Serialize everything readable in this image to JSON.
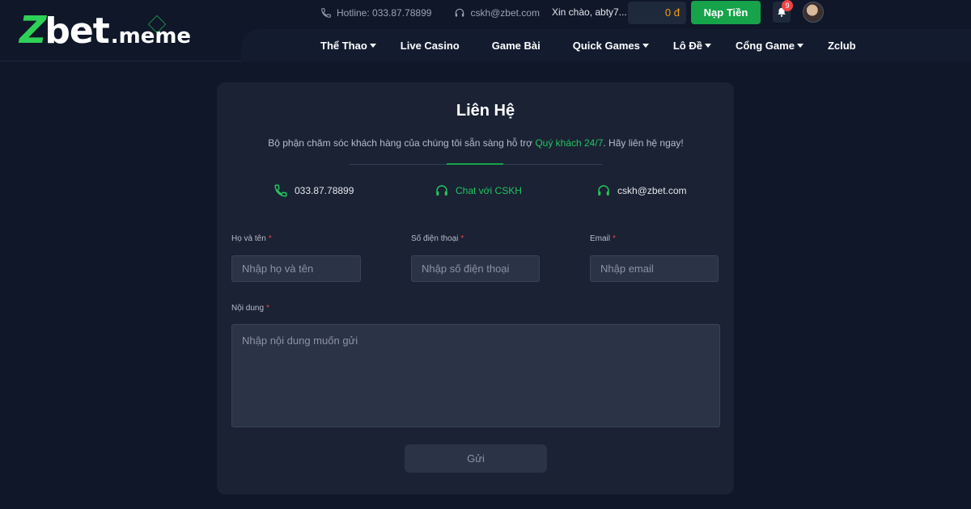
{
  "brand": {
    "logo_z": "Z",
    "logo_bet": "bet",
    "logo_domain": ".meme"
  },
  "topbar": {
    "hotline": "Hotline: 033.87.78899",
    "email": "cskh@zbet.com",
    "greeting": "Xin chào, abty7...",
    "balance": "0 đ",
    "deposit_label": "Nạp Tiền",
    "notification_count": "9"
  },
  "nav": {
    "items": [
      {
        "label": "Thể Thao",
        "dropdown": true
      },
      {
        "label": "Live Casino",
        "dropdown": false
      },
      {
        "label": "Game Bài",
        "dropdown": false
      },
      {
        "label": "Quick Games",
        "dropdown": true
      },
      {
        "label": "Lô Đề",
        "dropdown": true
      },
      {
        "label": "Cổng Game",
        "dropdown": true
      },
      {
        "label": "Zclub",
        "dropdown": false
      }
    ]
  },
  "contact_page": {
    "title": "Liên Hệ",
    "subtitle_start": "Bộ phận chăm sóc khách hàng của chúng tôi sẵn sàng hỗ trợ ",
    "subtitle_highlight": "Quý khách 24/7",
    "subtitle_end": ". Hãy liên hệ ngay!",
    "phone": "033.87.78899",
    "chat": "Chat với CSKH",
    "email": "cskh@zbet.com"
  },
  "form": {
    "name_label": "Họ và tên",
    "name_placeholder": "Nhập họ và tên",
    "phone_label": "Số điện thoại",
    "phone_placeholder": "Nhập số điện thoại",
    "email_label": "Email",
    "email_placeholder": "Nhập email",
    "message_label": "Nội dung",
    "message_placeholder": "Nhập nội dung muốn gửi",
    "required_mark": "*",
    "submit_label": "Gửi"
  },
  "colors": {
    "accent": "#16a34a",
    "highlight": "#22c55e",
    "balance": "#f59e0b",
    "required": "#ef4444",
    "background": "#0f1729",
    "card": "#1a2234"
  }
}
